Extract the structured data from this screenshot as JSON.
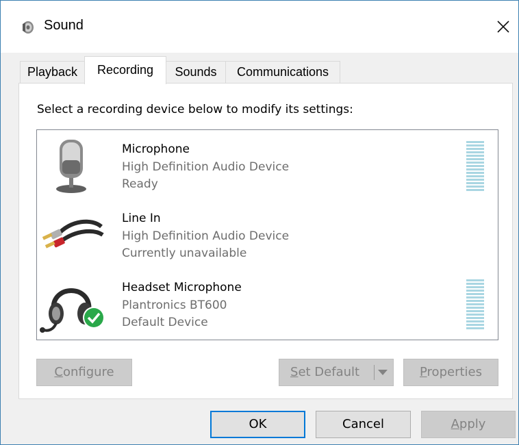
{
  "window": {
    "title": "Sound",
    "close_glyph": "✕",
    "app_icon": "speaker-icon"
  },
  "tabs": [
    {
      "label": "Playback",
      "active": false
    },
    {
      "label": "Recording",
      "active": true
    },
    {
      "label": "Sounds",
      "active": false
    },
    {
      "label": "Communications",
      "active": false
    }
  ],
  "recording": {
    "instructions": "Select a recording device below to modify its settings:",
    "devices": [
      {
        "name": "Microphone",
        "driver": "High Definition Audio Device",
        "status": "Ready",
        "icon": "microphone-icon",
        "level_meter": true
      },
      {
        "name": "Line In",
        "driver": "High Definition Audio Device",
        "status": "Currently unavailable",
        "icon": "rca-cable-icon",
        "level_meter": false
      },
      {
        "name": "Headset Microphone",
        "driver": "Plantronics BT600",
        "status": "Default Device",
        "icon": "headset-icon",
        "badge": "default-check-icon",
        "level_meter": true
      }
    ],
    "buttons": {
      "configure_pre": "",
      "configure_ul": "C",
      "configure_post": "onfigure",
      "set_default_pre": "",
      "set_default_ul": "S",
      "set_default_post": "et Default",
      "properties_pre": "",
      "properties_ul": "P",
      "properties_post": "roperties"
    }
  },
  "footer": {
    "ok": "OK",
    "cancel": "Cancel",
    "apply_ul": "A",
    "apply_post": "pply"
  },
  "colors": {
    "accent": "#0078d7",
    "meter": "#a9d6e2",
    "check_badge": "#2aa84a"
  }
}
